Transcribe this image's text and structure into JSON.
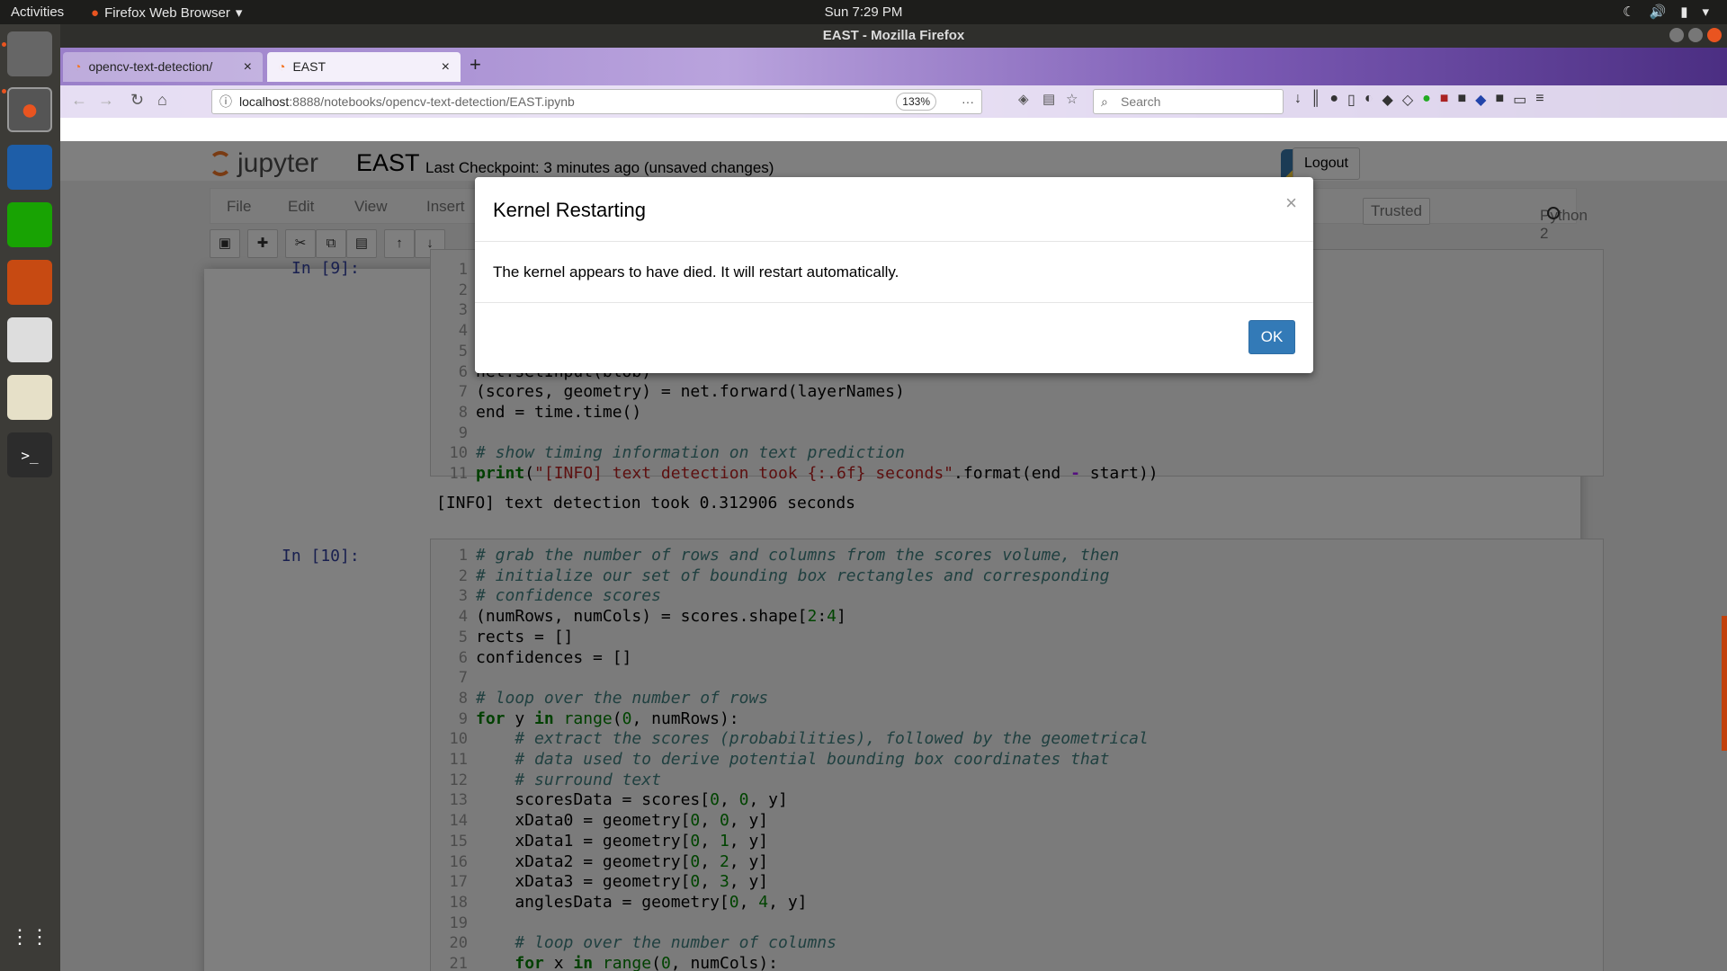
{
  "topbar": {
    "activities": "Activities",
    "app": "Firefox Web Browser",
    "clock": "Sun  7:29 PM"
  },
  "window": {
    "title": "EAST - Mozilla Firefox"
  },
  "tabs": [
    {
      "label": "opencv-text-detection/"
    },
    {
      "label": "EAST"
    }
  ],
  "url": {
    "host": "localhost",
    "path": ":8888/notebooks/opencv-text-detection/EAST.ipynb",
    "zoom": "133%"
  },
  "search": {
    "placeholder": "Search"
  },
  "jupyter": {
    "logo": "jupyter",
    "notebook": "EAST",
    "checkpoint": "Last Checkpoint: 3 minutes ago (unsaved changes)",
    "logout": "Logout",
    "trusted": "Trusted",
    "kernel": "Python 2"
  },
  "menu": [
    "File",
    "Edit",
    "View",
    "Insert"
  ],
  "cell9": {
    "prompt": "In [9]:",
    "output": "[INFO] text detection took 0.312906 seconds"
  },
  "cell10": {
    "prompt": "In [10]:"
  },
  "modal": {
    "title": "Kernel Restarting",
    "body": "The kernel appears to have died. It will restart automatically.",
    "ok": "OK",
    "close": "×"
  },
  "colors": {
    "accent": "#337ab7",
    "ubuntu": "#e95420",
    "jupyter": "#f37626"
  }
}
